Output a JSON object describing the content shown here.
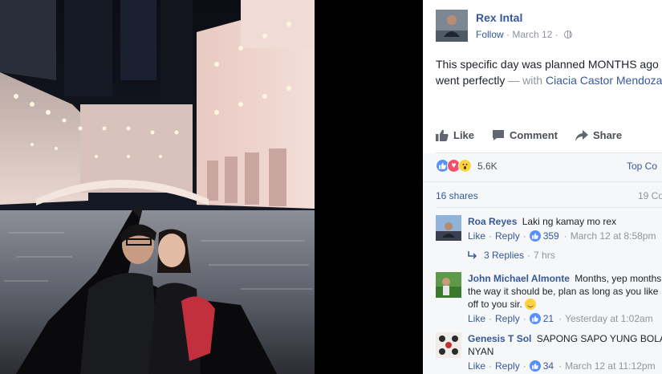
{
  "post": {
    "author": "Rex Intal",
    "follow_label": "Follow",
    "date": "March 12",
    "privacy_icon": "globe-icon",
    "text_main": "This specific day was planned MONTHS ago",
    "text_line2": "went perfectly",
    "with_label": "— with",
    "tagged": "Ciacia Castor Mendoza"
  },
  "actions": {
    "like": "Like",
    "comment": "Comment",
    "share": "Share"
  },
  "reactions": {
    "count": "5.6K",
    "top_comments_label": "Top Co"
  },
  "stats": {
    "shares": "16 shares",
    "comments": "19 Co"
  },
  "comments": [
    {
      "name": "Roa Reyes",
      "text": "Laki ng kamay mo rex",
      "like": "Like",
      "reply": "Reply",
      "likes": "359",
      "time": "March 12 at 8:58pm",
      "replies": "3 Replies",
      "replies_time": "7 hrs"
    },
    {
      "name": "John Michael Almonte",
      "text_line1": "Months, yep months,",
      "text_line2": "the way it should be, plan as long as you like",
      "text_line3": "off to you sir.",
      "like": "Like",
      "reply": "Reply",
      "likes": "21",
      "time": "Yesterday at 1:02am"
    },
    {
      "name": "Genesis T Sol",
      "text_line1": "SAPONG SAPO YUNG BOLA",
      "text_line2": "NYAN",
      "like": "Like",
      "reply": "Reply",
      "likes": "34",
      "time": "March 12 at 11:12pm"
    }
  ],
  "colors": {
    "link": "#365899",
    "muted": "#90949c",
    "like_blue": "#5890ff",
    "love_red": "#f25268",
    "wow_yellow": "#fcd240"
  }
}
